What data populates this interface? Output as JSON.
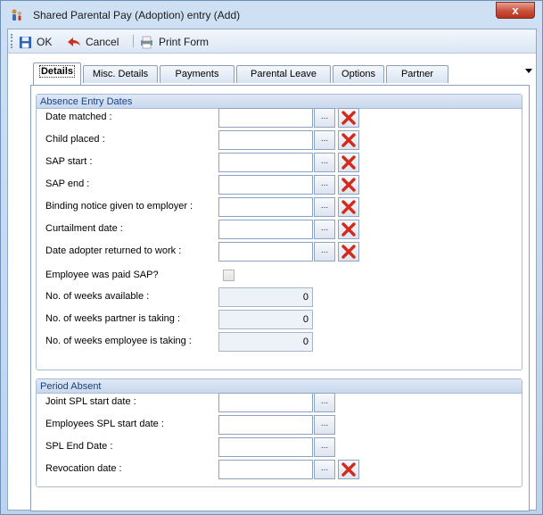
{
  "window": {
    "title": "Shared Parental Pay (Adoption) entry (Add)",
    "close_glyph": "x"
  },
  "toolbar": {
    "ok_label": "OK",
    "cancel_label": "Cancel",
    "print_label": "Print Form"
  },
  "tabs": [
    {
      "label": "Details",
      "active": true
    },
    {
      "label": "Misc. Details",
      "active": false
    },
    {
      "label": "Payments",
      "active": false
    },
    {
      "label": "Parental Leave",
      "active": false
    },
    {
      "label": "Options",
      "active": false
    },
    {
      "label": "Partner",
      "active": false
    }
  ],
  "absence": {
    "title": "Absence Entry Dates",
    "date_rows": [
      {
        "label": "Date matched :",
        "value": ""
      },
      {
        "label": "Child placed :",
        "value": ""
      },
      {
        "label": "SAP start :",
        "value": ""
      },
      {
        "label": "SAP end :",
        "value": ""
      },
      {
        "label": "Binding notice given to employer :",
        "value": ""
      },
      {
        "label": "Curtailment date :",
        "value": ""
      },
      {
        "label": "Date adopter returned to work :",
        "value": ""
      }
    ],
    "paid_sap_label": "Employee was paid SAP?",
    "paid_sap_checked": false,
    "num_rows": [
      {
        "label": "No. of weeks available :",
        "value": "0"
      },
      {
        "label": "No. of weeks partner is taking :",
        "value": "0"
      },
      {
        "label": "No. of weeks employee is taking :",
        "value": "0"
      }
    ]
  },
  "period": {
    "title": "Period Absent",
    "rows": [
      {
        "label": "Joint SPL start date :",
        "value": ""
      },
      {
        "label": "Employees SPL start date :",
        "value": ""
      },
      {
        "label": "SPL End Date :",
        "value": ""
      },
      {
        "label": "Revocation date :",
        "value": ""
      }
    ]
  },
  "button_glyphs": {
    "ellipsis": "...",
    "clear_icon": "red-x-icon"
  },
  "colors": {
    "clear_red": "#d42a1a",
    "group_header_text": "#15428b"
  }
}
